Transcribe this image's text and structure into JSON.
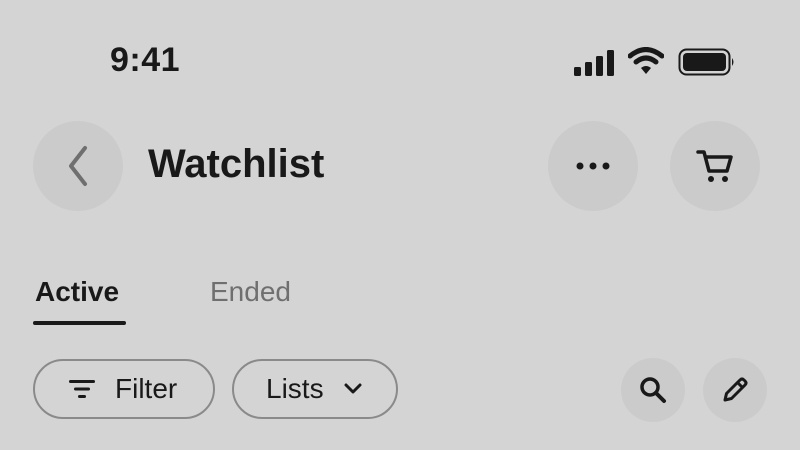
{
  "status_bar": {
    "time": "9:41",
    "icons": [
      "cellular-signal-icon",
      "wifi-icon",
      "battery-icon"
    ]
  },
  "header": {
    "title": "Watchlist",
    "back_icon": "chevron-left-icon",
    "more_icon": "more-horizontal-icon",
    "cart_icon": "cart-icon"
  },
  "tabs": [
    {
      "label": "Active",
      "selected": true
    },
    {
      "label": "Ended",
      "selected": false
    }
  ],
  "toolbar": {
    "filter_label": "Filter",
    "filter_icon": "filter-icon",
    "lists_label": "Lists",
    "lists_icon": "chevron-down-icon",
    "search_icon": "search-icon",
    "edit_icon": "pencil-icon"
  },
  "colors": {
    "background": "#d4d4d4",
    "button_bg": "#cbcbcb",
    "text_primary": "#191919",
    "text_secondary": "#6f6f6f",
    "pill_border": "#8a8a8a"
  }
}
